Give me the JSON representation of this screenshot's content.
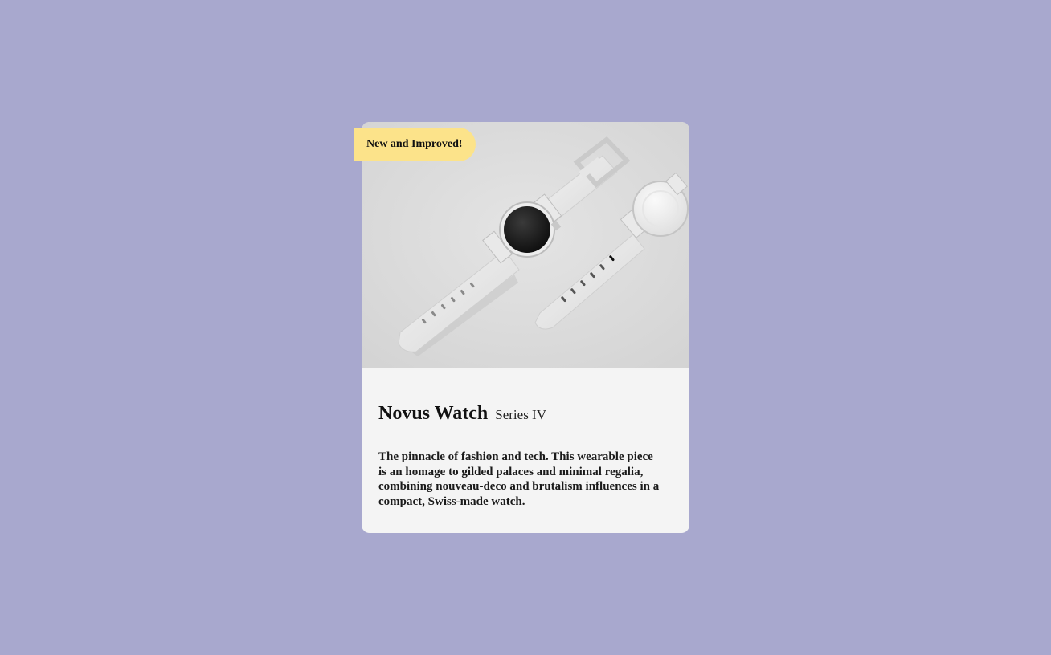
{
  "colors": {
    "background": "#a8a8ce",
    "card": "#f4f4f4",
    "badge": "#fce38a",
    "image_bg": "#dcdcdc"
  },
  "card": {
    "badge_label": "New and Improved!",
    "image_icon": "smartwatch-photo",
    "title": "Novus Watch",
    "subtitle": "Series IV",
    "description": "The pinnacle of fashion and tech. This wearable piece is an homage to gilded palaces and minimal regalia, combining nouveau-deco and brutalism influences in a compact, Swiss-made watch."
  }
}
